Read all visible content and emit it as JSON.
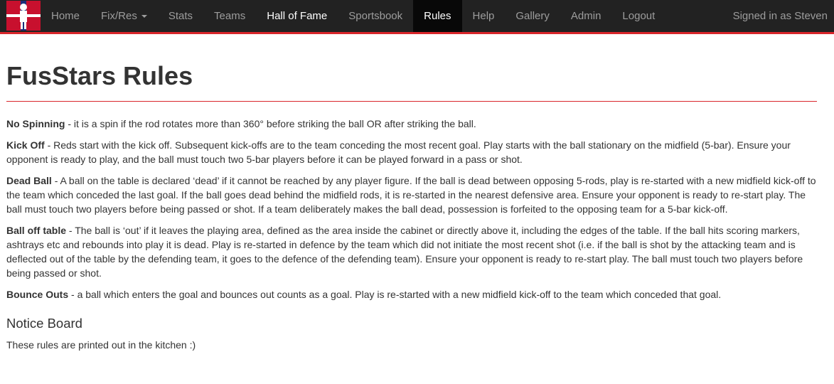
{
  "navbar": {
    "logo_icon": "foosball-player-flag-logo",
    "items": [
      {
        "label": "Home"
      },
      {
        "label": "Fix/Res"
      },
      {
        "label": "Stats"
      },
      {
        "label": "Teams"
      },
      {
        "label": "Hall of Fame"
      },
      {
        "label": "Sportsbook"
      },
      {
        "label": "Rules"
      },
      {
        "label": "Help"
      },
      {
        "label": "Gallery"
      },
      {
        "label": "Admin"
      },
      {
        "label": "Logout"
      }
    ],
    "active": "Rules",
    "signed_in": "Signed in as Steven",
    "accent_color": "#d9262b",
    "bg_color": "#222222"
  },
  "page": {
    "title": "FusStars Rules",
    "rules": [
      {
        "term": "No Spinning",
        "text": " - it is a spin if the rod rotates more than 360° before striking the ball OR after striking the ball."
      },
      {
        "term": "Kick Off",
        "text": " - Reds start with the kick off. Subsequent kick-offs are to the team conceding the most recent goal. Play starts with the ball stationary on the midfield (5-bar). Ensure your opponent is ready to play, and the ball must touch two 5-bar players before it can be played forward in a pass or shot."
      },
      {
        "term": "Dead Ball",
        "text": " - A ball on the table is declared ‘dead’ if it cannot be reached by any player figure. If the ball is dead between opposing 5-rods, play is re-started with a new midfield kick-off to the team which conceded the last goal. If the ball goes dead behind the midfield rods, it is re-started in the nearest defensive area. Ensure your opponent is ready to re-start play. The ball must touch two players before being passed or shot. If a team deliberately makes the ball dead, possession is forfeited to the opposing team for a 5-bar kick-off."
      },
      {
        "term": "Ball off table",
        "text": " - The ball is ‘out’ if it leaves the playing area, defined as the area inside the cabinet or directly above it, including the edges of the table. If the ball hits scoring markers, ashtrays etc and rebounds into play it is dead. Play is re-started in defence by the team which did not initiate the most recent shot (i.e. if the ball is shot by the attacking team and is deflected out of the table by the defending team, it goes to the defence of the defending team). Ensure your opponent is ready to re-start play. The ball must touch two players before being passed or shot."
      },
      {
        "term": "Bounce Outs",
        "text": " - a ball which enters the goal and bounces out counts as a goal. Play is re-started with a new midfield kick-off to the team which conceded that goal."
      }
    ],
    "notice_heading": "Notice Board",
    "notice_text": "These rules are printed out in the kitchen :)"
  }
}
